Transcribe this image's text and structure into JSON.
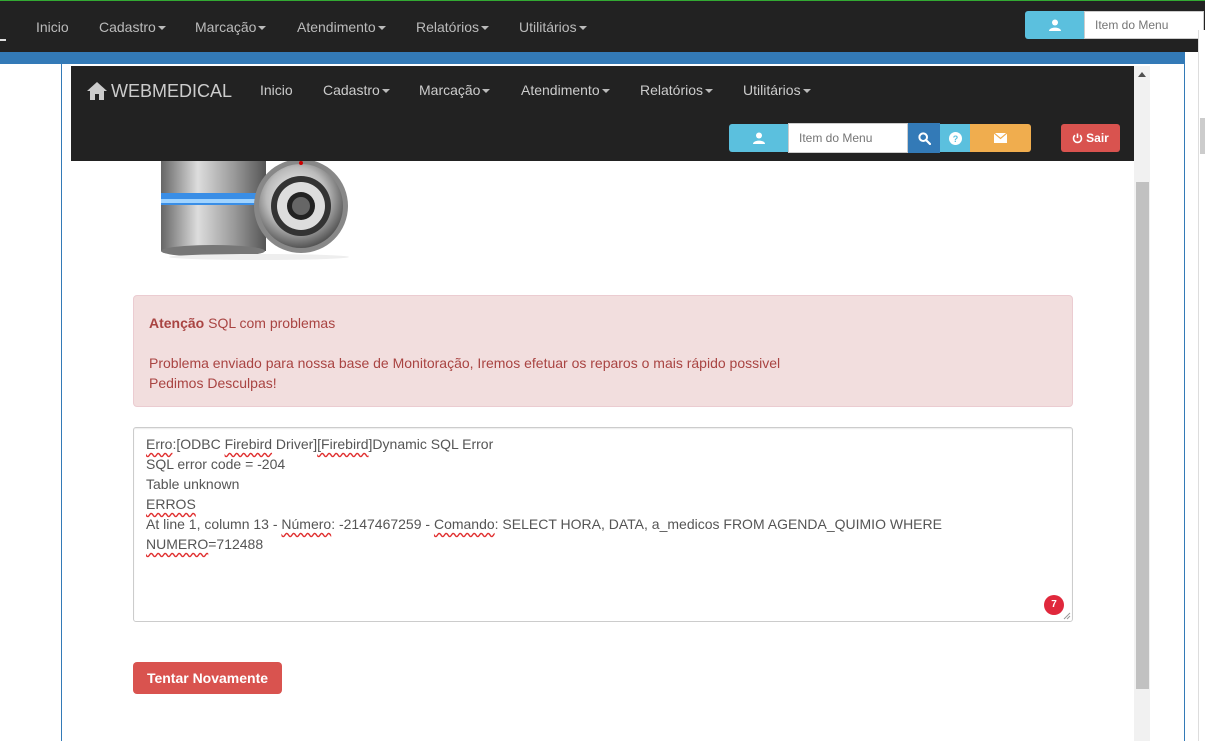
{
  "outer_nav": {
    "items": [
      "Inicio",
      "Cadastro",
      "Marcação",
      "Atendimento",
      "Relatórios",
      "Utilitários"
    ],
    "search_placeholder": "Item do Menu"
  },
  "inner_nav": {
    "brand": "WEBMEDICAL",
    "items": [
      "Inicio",
      "Cadastro",
      "Marcação",
      "Atendimento",
      "Relatórios",
      "Utilitários"
    ],
    "search_placeholder": "Item do Menu",
    "logout_label": "Sair"
  },
  "alert": {
    "strong": "Atenção",
    "title": "SQL com problemas",
    "line1": "Problema enviado para nossa base de Monitoração, Iremos efetuar os reparos o mais rápido possivel",
    "line2": "Pedimos Desculpas!"
  },
  "error": {
    "l1_erro": "Erro",
    "l1_a": ":[ODBC ",
    "l1_firebird": "Firebird",
    "l1_b": " Driver]",
    "l1_firebird2": "[Firebird",
    "l1_c": "]Dynamic SQL Error",
    "l2": "SQL error code = -204",
    "l3": "Table unknown",
    "l4": "ERROS",
    "l5_a": "At line 1, column 13 - ",
    "l5_numero": "Número",
    "l5_b": ": -2147467259 - ",
    "l5_comando": "Comando",
    "l5_c": ": SELECT HORA, DATA, a_medicos FROM AGENDA_QUIMIO WHERE",
    "l6_numero": "NUMERO",
    "l6_b": "=712488",
    "badge": "7"
  },
  "retry_label": "Tentar Novamente",
  "colors": {
    "navbar": "#222222",
    "info": "#5bc0de",
    "primary": "#337ab7",
    "warning": "#f0ad4e",
    "danger": "#d9534f",
    "alert_bg": "#f2dede",
    "alert_text": "#a94442"
  }
}
